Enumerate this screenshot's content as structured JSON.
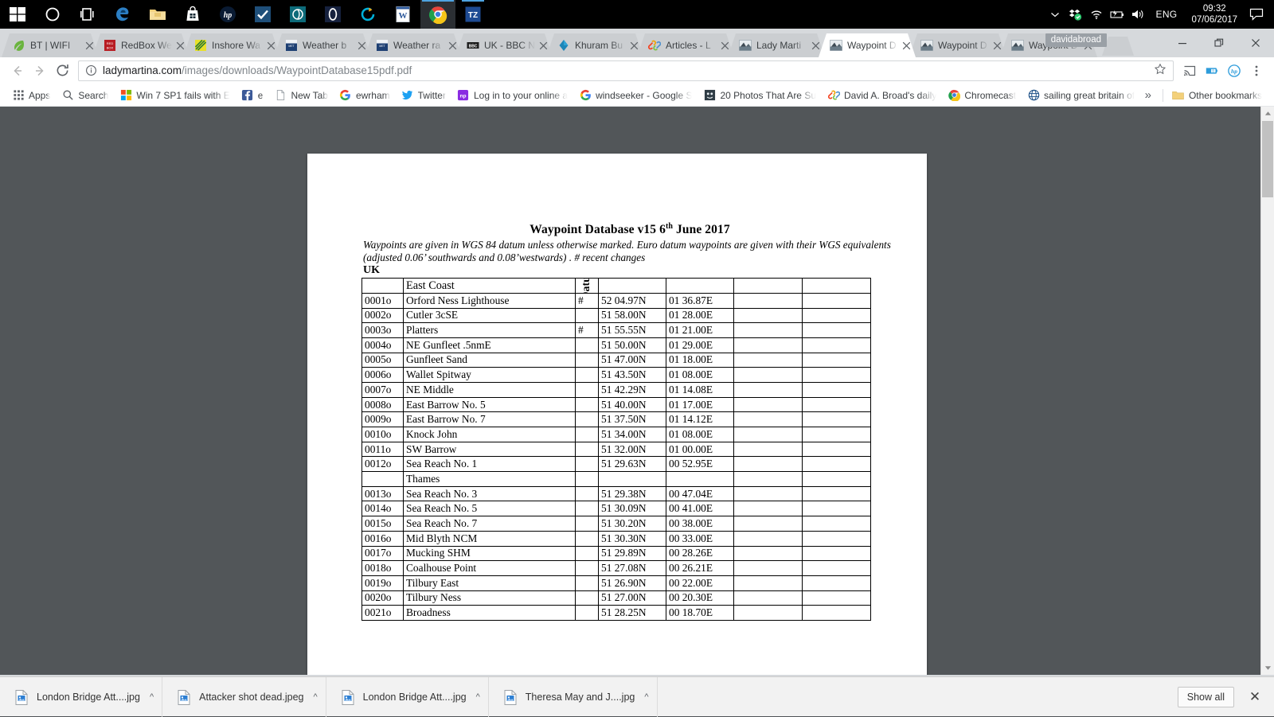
{
  "taskbar": {
    "icons": [
      {
        "name": "start-button",
        "glyph": "windows"
      },
      {
        "name": "cortana-button",
        "glyph": "circle"
      },
      {
        "name": "task-view-button",
        "glyph": "taskview"
      },
      {
        "name": "edge-taskbar-icon",
        "glyph": "edge"
      },
      {
        "name": "file-explorer-taskbar-icon",
        "glyph": "folder"
      },
      {
        "name": "store-taskbar-icon",
        "glyph": "store"
      },
      {
        "name": "hp-taskbar-icon",
        "glyph": "hp"
      },
      {
        "name": "checkmark-app-taskbar-icon",
        "glyph": "check"
      },
      {
        "name": "teal-app-taskbar-icon",
        "glyph": "teal"
      },
      {
        "name": "opera-taskbar-icon",
        "glyph": "opera"
      },
      {
        "name": "sync-app-taskbar-icon",
        "glyph": "sync"
      },
      {
        "name": "word-taskbar-icon",
        "glyph": "word"
      },
      {
        "name": "chrome-taskbar-icon",
        "glyph": "chrome"
      },
      {
        "name": "tz-app-taskbar-icon",
        "glyph": "tz"
      }
    ],
    "tray": {
      "chevron": "show-hidden-icons",
      "dropbox": "dropbox-icon",
      "wifi": "wifi-icon",
      "battery": "battery-icon",
      "volume": "volume-icon",
      "language": "ENG",
      "time": "09:32",
      "date": "07/06/2017",
      "action_center": "action-center-icon"
    }
  },
  "browser": {
    "tabs": [
      {
        "title": "BT | WIFI",
        "favicon": "leaf",
        "active": false
      },
      {
        "title": "RedBox We",
        "favicon": "redbox",
        "active": false
      },
      {
        "title": "Inshore Wa",
        "favicon": "inshore",
        "active": false
      },
      {
        "title": "Weather b",
        "favicon": "metoffice",
        "active": false
      },
      {
        "title": "Weather ra",
        "favicon": "metoffice",
        "active": false
      },
      {
        "title": "UK - BBC N",
        "favicon": "bbc",
        "active": false
      },
      {
        "title": "Khuram Bu",
        "favicon": "diamond",
        "active": false
      },
      {
        "title": "Articles - L",
        "favicon": "joomla",
        "active": false
      },
      {
        "title": "Lady Marti",
        "favicon": "boat",
        "active": false
      },
      {
        "title": "Waypoint D",
        "favicon": "boat",
        "active": true
      },
      {
        "title": "Waypoint D",
        "favicon": "boat",
        "active": false
      },
      {
        "title": "Waypoint D",
        "favicon": "boat",
        "active": false
      }
    ],
    "tab_close_label": "✕",
    "new_tab_label": "",
    "user_badge": "davidabroad",
    "window_controls": {
      "minimize": "—",
      "maximize": "❐",
      "close": "✕"
    },
    "nav": {
      "back": "←",
      "forward": "→",
      "reload": "↻"
    },
    "omnibox": {
      "url_host": "ladymartina.com",
      "url_path": "/images/downloads/WaypointDatabase15pdf.pdf",
      "info_icon": "site-info-icon",
      "star_icon": "bookmark-star-icon"
    },
    "toolbar_right": [
      {
        "name": "cast-icon"
      },
      {
        "name": "extension-icon"
      },
      {
        "name": "hp-extension-icon"
      },
      {
        "name": "chrome-menu-icon"
      }
    ],
    "bookmarks": [
      {
        "label": "Apps",
        "icon": "apps-grid-icon"
      },
      {
        "label": "Search",
        "icon": "search-icon"
      },
      {
        "label": "Win 7 SP1 fails with E",
        "icon": "microsoft-icon"
      },
      {
        "label": "e",
        "icon": "facebook-icon"
      },
      {
        "label": "New Tab",
        "icon": "page-icon"
      },
      {
        "label": "ewrham",
        "icon": "google-icon"
      },
      {
        "label": "Twitter",
        "icon": "twitter-icon"
      },
      {
        "label": "Log in to your online a",
        "icon": "np-icon"
      },
      {
        "label": "windseeker - Google S",
        "icon": "google-icon"
      },
      {
        "label": "20 Photos That Are Su",
        "icon": "photo-icon"
      },
      {
        "label": "David A. Broad's daily",
        "icon": "joomla-icon"
      },
      {
        "label": "Chromecast",
        "icon": "chrome-icon"
      },
      {
        "label": "sailing great britain of",
        "icon": "globe-icon"
      }
    ],
    "bookmarks_overflow": "»",
    "other_bookmarks": {
      "label": "Other bookmarks",
      "icon": "folder-icon"
    }
  },
  "document": {
    "title_main": "Waypoint Database v15 6",
    "title_sup": "th",
    "title_tail": " June 2017",
    "note": "Waypoints are given in WGS 84 datum unless otherwise marked. Euro datum waypoints are given with their WGS equivalents (adjusted 0.06’ southwards and 0.08’westwards) .  # recent changes",
    "country": "UK",
    "table": {
      "header": {
        "id": "",
        "region": "East Coast",
        "datum": "Datum",
        "lat": "",
        "lon": "",
        "extra1": "",
        "extra2": ""
      },
      "rows": [
        {
          "type": "data",
          "id": "0001o",
          "name": "Orford Ness Lighthouse",
          "datum": "#",
          "lat": "52 04.97N",
          "lon": "01 36.87E"
        },
        {
          "type": "data",
          "id": "0002o",
          "name": "Cutler 3cSE",
          "datum": "",
          "lat": "51 58.00N",
          "lon": "01 28.00E"
        },
        {
          "type": "data",
          "id": "0003o",
          "name": "Platters",
          "datum": "#",
          "lat": "51 55.55N",
          "lon": "01 21.00E"
        },
        {
          "type": "data",
          "id": "0004o",
          "name": "NE Gunfleet .5nmE",
          "datum": "",
          "lat": "51 50.00N",
          "lon": "01 29.00E"
        },
        {
          "type": "data",
          "id": "0005o",
          "name": "Gunfleet Sand",
          "datum": "",
          "lat": "51 47.00N",
          "lon": "01 18.00E"
        },
        {
          "type": "data",
          "id": "0006o",
          "name": "Wallet Spitway",
          "datum": "",
          "lat": "51 43.50N",
          "lon": "01 08.00E"
        },
        {
          "type": "data",
          "id": "0007o",
          "name": "NE Middle",
          "datum": "",
          "lat": "51 42.29N",
          "lon": "01 14.08E"
        },
        {
          "type": "data",
          "id": "0008o",
          "name": "East Barrow No. 5",
          "datum": "",
          "lat": "51 40.00N",
          "lon": "01 17.00E"
        },
        {
          "type": "data",
          "id": "0009o",
          "name": "East Barrow No. 7",
          "datum": "",
          "lat": "51 37.50N",
          "lon": "01 14.12E"
        },
        {
          "type": "data",
          "id": "0010o",
          "name": "Knock John",
          "datum": "",
          "lat": "51 34.00N",
          "lon": "01 08.00E"
        },
        {
          "type": "data",
          "id": "0011o",
          "name": "SW Barrow",
          "datum": "",
          "lat": "51 32.00N",
          "lon": "01 00.00E"
        },
        {
          "type": "data",
          "id": "0012o",
          "name": "Sea Reach No. 1",
          "datum": "",
          "lat": "51 29.63N",
          "lon": "00 52.95E"
        },
        {
          "type": "section",
          "id": "",
          "name": "Thames",
          "datum": "",
          "lat": "",
          "lon": ""
        },
        {
          "type": "data",
          "id": "0013o",
          "name": "Sea Reach No. 3",
          "datum": "",
          "lat": "51 29.38N",
          "lon": "00 47.04E"
        },
        {
          "type": "data",
          "id": "0014o",
          "name": "Sea Reach No. 5",
          "datum": "",
          "lat": "51 30.09N",
          "lon": "00 41.00E"
        },
        {
          "type": "data",
          "id": "0015o",
          "name": "Sea Reach No. 7",
          "datum": "",
          "lat": "51 30.20N",
          "lon": "00 38.00E"
        },
        {
          "type": "data",
          "id": "0016o",
          "name": "Mid Blyth NCM",
          "datum": "",
          "lat": "51 30.30N",
          "lon": "00 33.00E"
        },
        {
          "type": "data",
          "id": "0017o",
          "name": "Mucking SHM",
          "datum": "",
          "lat": "51 29.89N",
          "lon": "00 28.26E"
        },
        {
          "type": "data",
          "id": "0018o",
          "name": "Coalhouse Point",
          "datum": "",
          "lat": "51 27.08N",
          "lon": "00 26.21E"
        },
        {
          "type": "data",
          "id": "0019o",
          "name": "Tilbury East",
          "datum": "",
          "lat": "51 26.90N",
          "lon": "00 22.00E"
        },
        {
          "type": "data",
          "id": "0020o",
          "name": "Tilbury Ness",
          "datum": "",
          "lat": "51 27.00N",
          "lon": "00 20.30E"
        },
        {
          "type": "data",
          "id": "0021o",
          "name": "Broadness",
          "datum": "",
          "lat": "51 28.25N",
          "lon": "00 18.70E"
        }
      ]
    }
  },
  "downloads": {
    "items": [
      {
        "name": "London Bridge Att....jpg",
        "icon": "image-file-icon",
        "caret": "^"
      },
      {
        "name": "Attacker shot dead.jpeg",
        "icon": "image-file-icon",
        "caret": "^"
      },
      {
        "name": "London Bridge Att....jpg",
        "icon": "image-file-icon",
        "caret": "^"
      },
      {
        "name": "Theresa May and J....jpg",
        "icon": "image-file-icon",
        "caret": "^"
      }
    ],
    "show_all": "Show all",
    "close": "✕"
  },
  "colors": {
    "taskbar_bg": "#000000",
    "chrome_frame": "#d6d9dc",
    "viewer_bg": "#525659",
    "accent_blue": "#4ea3e0",
    "page_white": "#ffffff"
  }
}
